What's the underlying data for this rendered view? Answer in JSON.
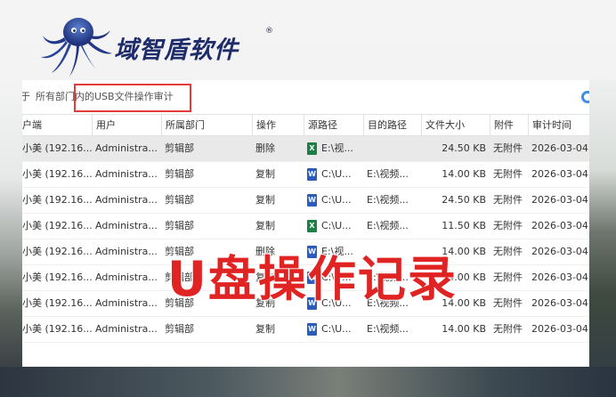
{
  "logo": {
    "brand": "域智盾软件",
    "reg_mark": "®"
  },
  "breadcrumb": {
    "prefix": "于",
    "all_departments": "所有部门",
    "scope": "内的USB文件操作审计"
  },
  "colors": {
    "accent_red": "#e23b3b",
    "caption_red": "#e02424",
    "selected_row": "#e9e9e9",
    "excel_green": "#1e7f45",
    "word_blue": "#2b5bbb"
  },
  "table": {
    "columns": [
      "户端",
      "用户",
      "所属部门",
      "操作",
      "源路径",
      "目的路径",
      "文件大小",
      "附件",
      "审计时间"
    ],
    "rows": [
      {
        "client": "小美 (192.16...",
        "user": "Administra...",
        "dept": "剪辑部",
        "op": "删除",
        "src_icon": "excel-icon",
        "src_glyph": "X",
        "src": "E:\\视...",
        "dst": "",
        "size": "24.50 KB",
        "attach": "无附件",
        "time": "2026-03-04"
      },
      {
        "client": "小美 (192.16...",
        "user": "Administra...",
        "dept": "剪辑部",
        "op": "复制",
        "src_icon": "word-icon",
        "src_glyph": "W",
        "src": "C:\\U...",
        "dst": "E:\\视频...",
        "size": "14.00 KB",
        "attach": "无附件",
        "time": "2026-03-04"
      },
      {
        "client": "小美 (192.16...",
        "user": "Administra...",
        "dept": "剪辑部",
        "op": "复制",
        "src_icon": "word-icon",
        "src_glyph": "W",
        "src": "C:\\U...",
        "dst": "E:\\视频...",
        "size": "24.50 KB",
        "attach": "无附件",
        "time": "2026-03-04"
      },
      {
        "client": "小美 (192.16...",
        "user": "Administra...",
        "dept": "剪辑部",
        "op": "复制",
        "src_icon": "excel-icon",
        "src_glyph": "X",
        "src": "C:\\U...",
        "dst": "E:\\视频...",
        "size": "11.50 KB",
        "attach": "无附件",
        "time": "2026-03-04"
      },
      {
        "client": "小美 (192.16...",
        "user": "Administra...",
        "dept": "剪辑部",
        "op": "删除",
        "src_icon": "word-icon",
        "src_glyph": "W",
        "src": "E:\\视...",
        "dst": "",
        "size": "14.00 KB",
        "attach": "无附件",
        "time": "2026-03-04"
      },
      {
        "client": "小美 (192.16...",
        "user": "Administra...",
        "dept": "剪辑部",
        "op": "复制",
        "src_icon": "word-icon",
        "src_glyph": "W",
        "src": "C:\\U...",
        "dst": "E:\\视频...",
        "size": "14.00 KB",
        "attach": "无附件",
        "time": "2026-03-04"
      },
      {
        "client": "小美 (192.16...",
        "user": "Administra...",
        "dept": "剪辑部",
        "op": "复制",
        "src_icon": "word-icon",
        "src_glyph": "W",
        "src": "C:\\U...",
        "dst": "E:\\视频...",
        "size": "14.00 KB",
        "attach": "无附件",
        "time": "2026-03-04"
      },
      {
        "client": "小美 (192.16...",
        "user": "Administra...",
        "dept": "剪辑部",
        "op": "复制",
        "src_icon": "word-icon",
        "src_glyph": "W",
        "src": "C:\\U...",
        "dst": "E:\\视频...",
        "size": "14.00 KB",
        "attach": "无附件",
        "time": "2026-03-04"
      }
    ]
  },
  "caption": "U盘操作记录"
}
